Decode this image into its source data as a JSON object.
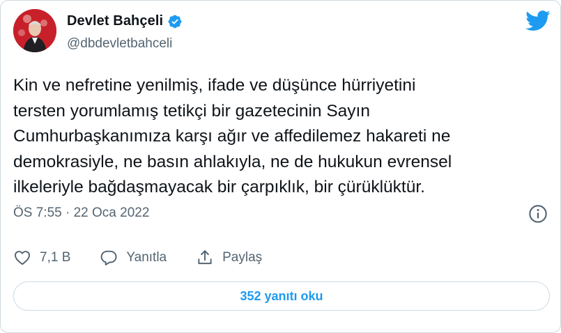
{
  "author": {
    "display_name": "Devlet Bahçeli",
    "handle": "@dbdevletbahceli",
    "verified": true,
    "avatar_icon": "avatar"
  },
  "tweet": {
    "text": "Kin ve nefretine yenilmiş, ifade ve düşünce hürriyetini\ntersten yorumlamış tetikçi bir gazetecinin Sayın\nCumhurbaşkanımıza karşı ağır ve affedilemez hakareti ne\ndemokrasiyle, ne basın ahlakıyla, ne de hukukun evrensel\nilkeleriyle bağdaşmayacak bir çarpıklık, bir çürüklüktür.",
    "timestamp": "ÖS 7:55 · 22 Oca 2022"
  },
  "actions": {
    "like_count": "7,1 B",
    "reply_label": "Yanıtla",
    "share_label": "Paylaş"
  },
  "read_replies_label": "352 yanıtı oku",
  "colors": {
    "brand_blue": "#1d9bf0",
    "text_primary": "#0f1419",
    "text_secondary": "#536471",
    "border": "#cfd9de"
  },
  "icons": {
    "logo": "twitter-bird-icon",
    "verified": "verified-badge-icon",
    "info": "info-icon",
    "like": "heart-icon",
    "reply": "comment-icon",
    "share": "share-icon"
  }
}
